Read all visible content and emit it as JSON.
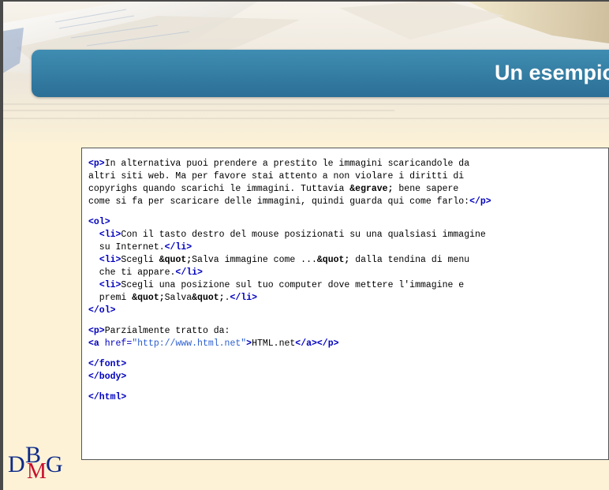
{
  "slide": {
    "title": "Un esempio"
  },
  "logo": {
    "text": "DBMG",
    "letters": [
      "D",
      "B",
      "M",
      "G"
    ],
    "colors": {
      "main": "#0d2a8a",
      "accent": "#c8102e"
    }
  },
  "colors": {
    "title_bar": "#2c6f96",
    "background": "#fdf2d6",
    "tag": "#0000c0",
    "string": "#2d5fd0"
  },
  "code": {
    "lines": [
      [
        {
          "t": "tag",
          "v": "<p>"
        },
        {
          "t": "text",
          "v": "In alternativa puoi prendere a prestito le immagini scaricandole da"
        }
      ],
      [
        {
          "t": "text",
          "v": "altri siti web. Ma per favore stai attento a non violare i diritti di"
        }
      ],
      [
        {
          "t": "text",
          "v": "copyrighs quando scarichi le immagini. Tuttavia "
        },
        {
          "t": "ent",
          "v": "&egrave;"
        },
        {
          "t": "text",
          "v": " bene sapere"
        }
      ],
      [
        {
          "t": "text",
          "v": "come si fa per scaricare delle immagini, quindi guarda qui come farlo:"
        },
        {
          "t": "tag",
          "v": "</p>"
        }
      ],
      [],
      [
        {
          "t": "tag",
          "v": "<ol>"
        }
      ],
      [
        {
          "t": "text",
          "v": "  "
        },
        {
          "t": "tag",
          "v": "<li>"
        },
        {
          "t": "text",
          "v": "Con il tasto destro del mouse posizionati su una qualsiasi immagine"
        }
      ],
      [
        {
          "t": "text",
          "v": "  su Internet."
        },
        {
          "t": "tag",
          "v": "</li>"
        }
      ],
      [
        {
          "t": "text",
          "v": "  "
        },
        {
          "t": "tag",
          "v": "<li>"
        },
        {
          "t": "text",
          "v": "Scegli "
        },
        {
          "t": "ent",
          "v": "&quot;"
        },
        {
          "t": "text",
          "v": "Salva immagine come ..."
        },
        {
          "t": "ent",
          "v": "&quot;"
        },
        {
          "t": "text",
          "v": " dalla tendina di menu"
        }
      ],
      [
        {
          "t": "text",
          "v": "  che ti appare."
        },
        {
          "t": "tag",
          "v": "</li>"
        }
      ],
      [
        {
          "t": "text",
          "v": "  "
        },
        {
          "t": "tag",
          "v": "<li>"
        },
        {
          "t": "text",
          "v": "Scegli una posizione sul tuo computer dove mettere l'immagine e"
        }
      ],
      [
        {
          "t": "text",
          "v": "  premi "
        },
        {
          "t": "ent",
          "v": "&quot;"
        },
        {
          "t": "text",
          "v": "Salva"
        },
        {
          "t": "ent",
          "v": "&quot;"
        },
        {
          "t": "text",
          "v": "."
        },
        {
          "t": "tag",
          "v": "</li>"
        }
      ],
      [
        {
          "t": "tag",
          "v": "</ol>"
        }
      ],
      [],
      [
        {
          "t": "tag",
          "v": "<p>"
        },
        {
          "t": "text",
          "v": "Parzialmente tratto da:"
        }
      ],
      [
        {
          "t": "tag",
          "v": "<a "
        },
        {
          "t": "attr",
          "v": "href="
        },
        {
          "t": "str",
          "v": "\"http://www.html.net\""
        },
        {
          "t": "tag",
          "v": ">"
        },
        {
          "t": "text",
          "v": "HTML.net"
        },
        {
          "t": "tag",
          "v": "</a></p>"
        }
      ],
      [],
      [
        {
          "t": "tag",
          "v": "</font>"
        }
      ],
      [
        {
          "t": "tag",
          "v": "</body>"
        }
      ],
      [],
      [
        {
          "t": "tag",
          "v": "</html>"
        }
      ]
    ]
  }
}
